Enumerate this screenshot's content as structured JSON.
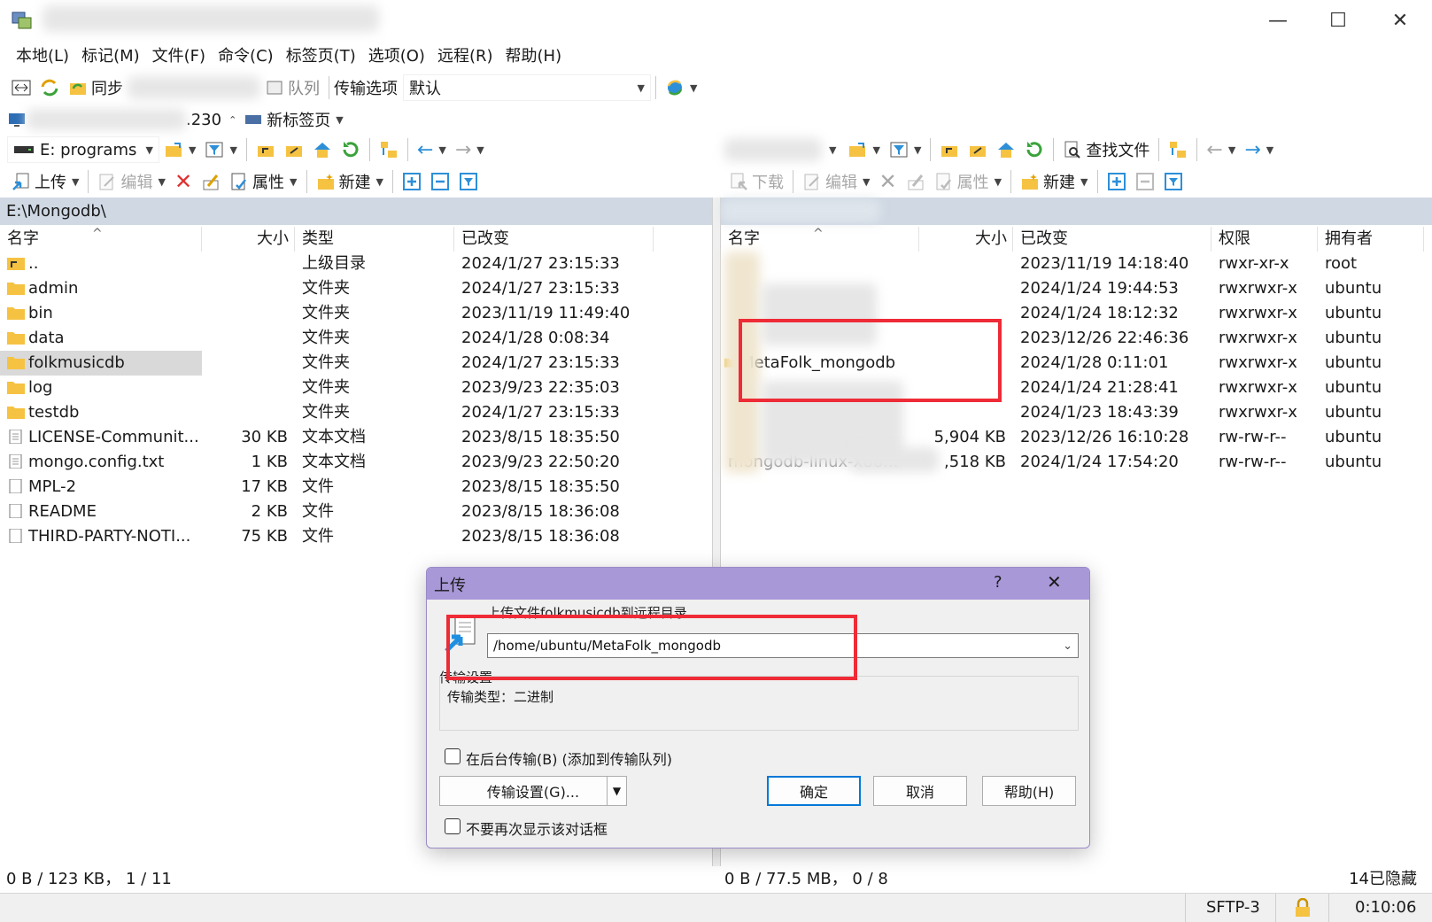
{
  "window": {
    "controls": {
      "minimize": "—",
      "maximize": "☐",
      "close": "✕"
    }
  },
  "menu": [
    "本地(L)",
    "标记(M)",
    "文件(F)",
    "命令(C)",
    "标签页(T)",
    "选项(O)",
    "远程(R)",
    "帮助(H)"
  ],
  "toolbar1": {
    "sync_label": "同步",
    "queue_label": "队列",
    "transfer_options_label": "传输选项",
    "transfer_preset": "默认"
  },
  "tabs_row": {
    "tab_fragment": ".230",
    "new_tab": "新标签页"
  },
  "local": {
    "drive": "E: programs",
    "upload_label": "上传",
    "edit_label": "编辑",
    "properties_label": "属性",
    "new_label": "新建",
    "path": "E:\\Mongodb\\",
    "columns": [
      "名字",
      "大小",
      "类型",
      "已改变"
    ],
    "files": [
      {
        "name": "..",
        "size": "",
        "type": "上级目录",
        "changed": "2024/1/27 23:15:33",
        "kind": "up"
      },
      {
        "name": "admin",
        "size": "",
        "type": "文件夹",
        "changed": "2024/1/27 23:15:33",
        "kind": "folder"
      },
      {
        "name": "bin",
        "size": "",
        "type": "文件夹",
        "changed": "2023/11/19 11:49:40",
        "kind": "folder"
      },
      {
        "name": "data",
        "size": "",
        "type": "文件夹",
        "changed": "2024/1/28 0:08:34",
        "kind": "folder"
      },
      {
        "name": "folkmusicdb",
        "size": "",
        "type": "文件夹",
        "changed": "2024/1/27 23:15:33",
        "kind": "folder"
      },
      {
        "name": "log",
        "size": "",
        "type": "文件夹",
        "changed": "2023/9/23 22:35:03",
        "kind": "folder"
      },
      {
        "name": "testdb",
        "size": "",
        "type": "文件夹",
        "changed": "2024/1/27 23:15:33",
        "kind": "folder"
      },
      {
        "name": "LICENSE-Communit...",
        "size": "30 KB",
        "type": "文本文档",
        "changed": "2023/8/15 18:35:50",
        "kind": "text"
      },
      {
        "name": "mongo.config.txt",
        "size": "1 KB",
        "type": "文本文档",
        "changed": "2023/9/23 22:50:20",
        "kind": "text"
      },
      {
        "name": "MPL-2",
        "size": "17 KB",
        "type": "文件",
        "changed": "2023/8/15 18:35:50",
        "kind": "file"
      },
      {
        "name": "README",
        "size": "2 KB",
        "type": "文件",
        "changed": "2023/8/15 18:36:08",
        "kind": "file"
      },
      {
        "name": "THIRD-PARTY-NOTI...",
        "size": "75 KB",
        "type": "文件",
        "changed": "2023/8/15 18:36:08",
        "kind": "file"
      }
    ],
    "status": "0 B / 123 KB， 1 / 11"
  },
  "remote": {
    "find_files_label": "查找文件",
    "download_label": "下载",
    "edit_label": "编辑",
    "properties_label": "属性",
    "new_label": "新建",
    "columns": [
      "名字",
      "大小",
      "已改变",
      "权限",
      "拥有者"
    ],
    "files": [
      {
        "name": "",
        "size": "",
        "changed": "2023/11/19 14:18:40",
        "rights": "rwxr-xr-x",
        "owner": "root"
      },
      {
        "name": "",
        "size": "",
        "changed": "2024/1/24 19:44:53",
        "rights": "rwxrwxr-x",
        "owner": "ubuntu"
      },
      {
        "name": "",
        "size": "",
        "changed": "2024/1/24 18:12:32",
        "rights": "rwxrwxr-x",
        "owner": "ubuntu"
      },
      {
        "name": "",
        "size": "",
        "changed": "2023/12/26 22:46:36",
        "rights": "rwxrwxr-x",
        "owner": "ubuntu"
      },
      {
        "name": "MetaFolk_mongodb",
        "size": "",
        "changed": "2024/1/28 0:11:01",
        "rights": "rwxrwxr-x",
        "owner": "ubuntu"
      },
      {
        "name": "",
        "size": "",
        "changed": "2024/1/24 21:28:41",
        "rights": "rwxrwxr-x",
        "owner": "ubuntu"
      },
      {
        "name": "",
        "size": "",
        "changed": "2024/1/23 18:43:39",
        "rights": "rwxrwxr-x",
        "owner": "ubuntu"
      },
      {
        "name": "",
        "size": "5,904 KB",
        "changed": "2023/12/26 16:10:28",
        "rights": "rw-rw-r--",
        "owner": "ubuntu"
      },
      {
        "name": "mongodb-linux-x86...",
        "size": ",518 KB",
        "changed": "2024/1/24 17:54:20",
        "rights": "rw-rw-r--",
        "owner": "ubuntu"
      }
    ],
    "status": "0 B / 77.5 MB， 0 / 8",
    "hidden": "14已隐藏"
  },
  "bottom": {
    "protocol": "SFTP-3",
    "time": "0:10:06"
  },
  "dialog": {
    "title": "上传",
    "help_glyph": "?",
    "close_glyph": "✕",
    "prompt": "上传文件folkmusicdb到远程目录",
    "target_path": "/home/ubuntu/MetaFolk_mongodb",
    "group_label": "传输设置",
    "transfer_type": "传输类型：二进制",
    "background_label": "在后台传输(B) (添加到传输队列)",
    "settings_button": "传输设置(G)...",
    "ok": "确定",
    "cancel": "取消",
    "help": "帮助(H)",
    "dont_show": "不要再次显示该对话框"
  },
  "colors": {
    "accent": "#0078d7",
    "highlight": "#ee2b36",
    "dialog_title": "#a898d8",
    "folder": "#f5c242"
  }
}
